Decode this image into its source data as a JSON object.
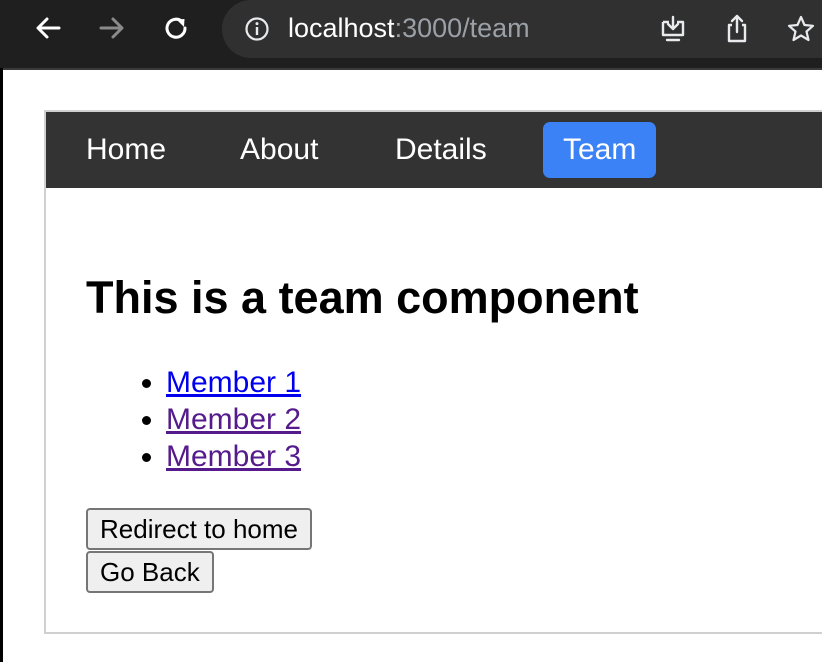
{
  "browser": {
    "url_host": "localhost",
    "url_path": ":3000/team",
    "icons": [
      "back-arrow-icon",
      "forward-arrow-icon",
      "reload-icon",
      "site-info-icon",
      "install-app-icon",
      "share-icon",
      "bookmark-star-icon"
    ]
  },
  "nav": {
    "items": [
      {
        "label": "Home"
      },
      {
        "label": "About"
      },
      {
        "label": "Details"
      },
      {
        "label": "Team",
        "active": true
      }
    ],
    "active_color": "#3b82f6",
    "background": "#333333"
  },
  "main": {
    "title": "This is a team component",
    "members": [
      {
        "label": "Member 1",
        "visited": false
      },
      {
        "label": "Member 2",
        "visited": true
      },
      {
        "label": "Member 3",
        "visited": true
      }
    ],
    "redirect_button": "Redirect to home",
    "back_button": "Go Back"
  },
  "colors": {
    "link_unvisited": "#0000ee",
    "link_visited": "#551a8b"
  }
}
